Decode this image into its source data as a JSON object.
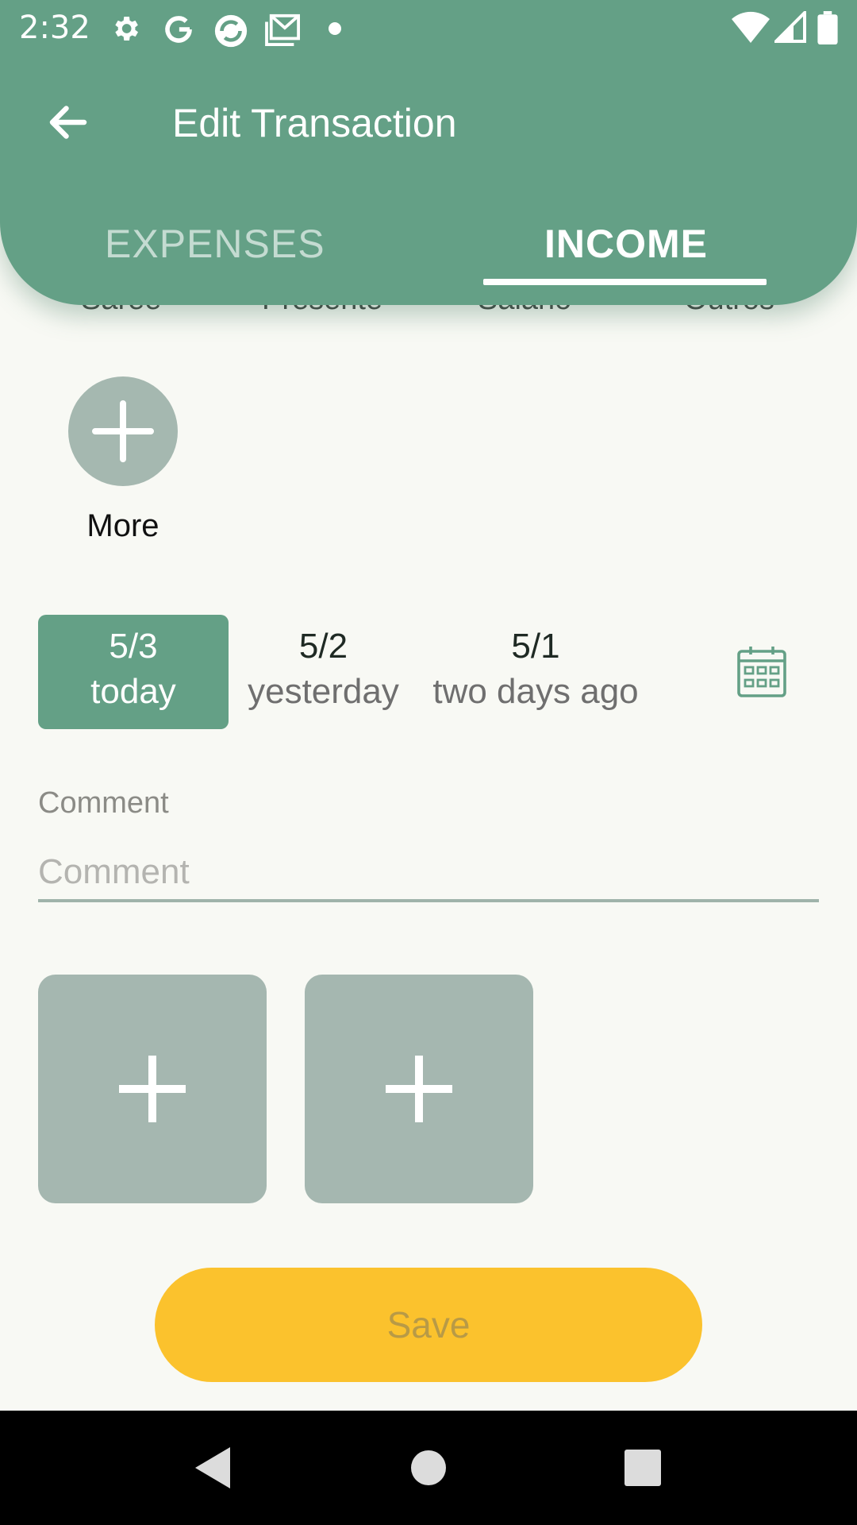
{
  "status_bar": {
    "time": "2:32",
    "icons": [
      "gear-icon",
      "google-icon",
      "sync-icon",
      "mail-icon",
      "dot-icon",
      "wifi-icon",
      "signal-icon",
      "battery-icon"
    ]
  },
  "toolbar": {
    "title": "Edit Transaction",
    "back_icon": "arrow-left-icon"
  },
  "tabs": [
    {
      "label": "EXPENSES",
      "selected": false
    },
    {
      "label": "INCOME",
      "selected": true
    }
  ],
  "categories_peek": [
    "Saree",
    "Presente",
    "Salario",
    "Outros"
  ],
  "more_button": {
    "label": "More",
    "icon": "plus-icon"
  },
  "dates": [
    {
      "date": "5/3",
      "label": "today",
      "selected": true
    },
    {
      "date": "5/2",
      "label": "yesterday",
      "selected": false
    },
    {
      "date": "5/1",
      "label": "two days ago",
      "selected": false
    }
  ],
  "calendar_icon": "calendar-icon",
  "comment": {
    "label": "Comment",
    "placeholder": "Comment",
    "value": ""
  },
  "attachments": [
    {
      "icon": "plus-icon"
    },
    {
      "icon": "plus-icon"
    }
  ],
  "save_button": {
    "label": "Save"
  },
  "colors": {
    "primary": "#64a086",
    "accent": "#fbc22d",
    "tile": "#a5b7b0",
    "background": "#f8f9f4"
  }
}
